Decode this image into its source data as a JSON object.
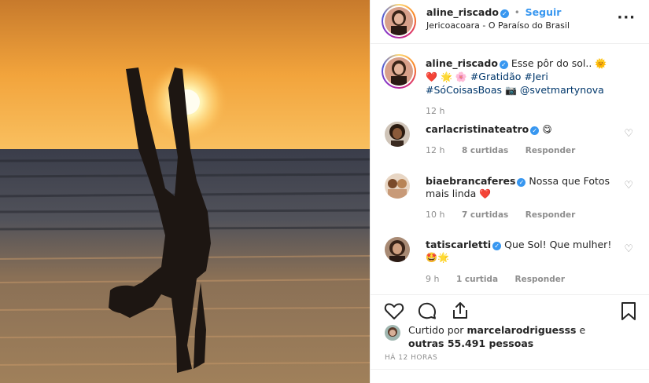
{
  "post": {
    "username": "aline_riscado",
    "follow_label": "Seguir",
    "location": "Jericoacoara - O Paraíso do Brasil",
    "more_icon": "ellipsis-icon"
  },
  "caption": {
    "username": "aline_riscado",
    "text": "Esse pôr do sol..",
    "hashtags": "#Gratidão #Jeri",
    "hashtags2": "#SóCoisasBoas",
    "mention": "@svetmartynova",
    "time": "12 h",
    "emoji_sun": "🌞",
    "emoji_heart": "❤️",
    "emoji_sparkle": "🌟",
    "emoji_flower": "🌸",
    "emoji_camera": "📷"
  },
  "comments": [
    {
      "username": "carlacristinateatro",
      "text": "",
      "emoji": "😋",
      "time": "12 h",
      "likes": "8 curtidas",
      "reply": "Responder"
    },
    {
      "username": "biaebrancaferes",
      "text": "Nossa que Fotos mais linda",
      "emoji": "❤️",
      "time": "10 h",
      "likes": "7 curtidas",
      "reply": "Responder"
    },
    {
      "username": "tatiscarletti",
      "text": "Que Sol! Que mulher!",
      "emoji": "🤩🌟",
      "time": "9 h",
      "likes": "1 curtida",
      "reply": "Responder"
    }
  ],
  "likes_line": {
    "prefix": "Curtido por",
    "user": "marcelarodriguesss",
    "suffix": "e",
    "others": "outras 55.491 pessoas"
  },
  "time_ago": "HÁ 12 HORAS",
  "colors": {
    "accent": "#3897f0",
    "text": "#262626",
    "muted": "#8e8e8e",
    "link": "#00376b",
    "heart": "#ed4956"
  }
}
